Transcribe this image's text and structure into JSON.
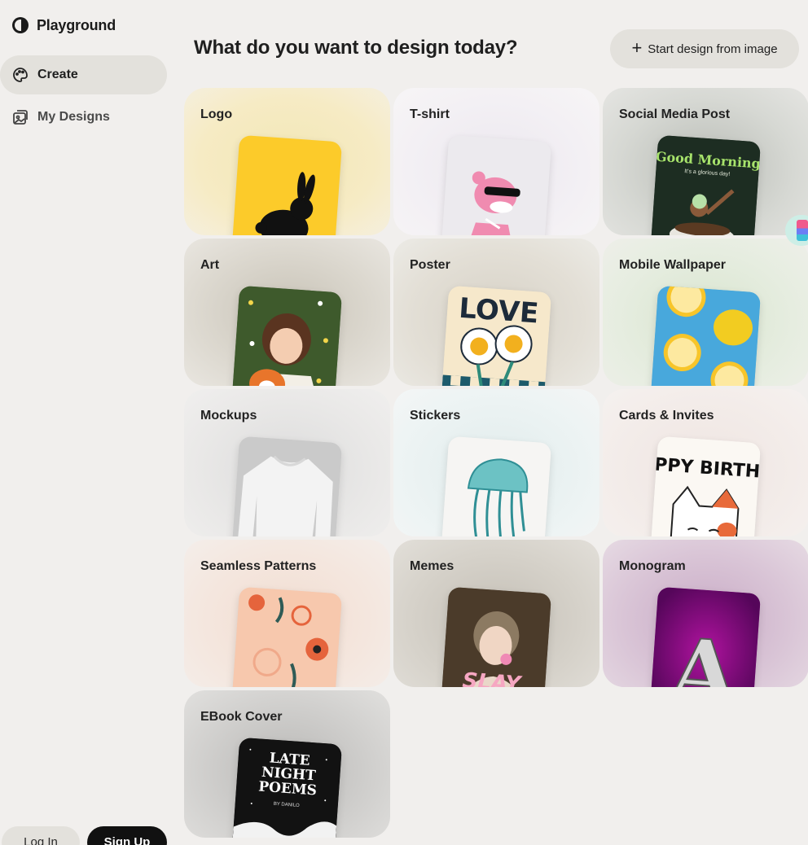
{
  "app": {
    "name": "Playground"
  },
  "sidebar": {
    "items": [
      {
        "label": "Create",
        "icon": "palette-icon",
        "active": true
      },
      {
        "label": "My Designs",
        "icon": "gallery-icon",
        "active": false
      }
    ],
    "login_label": "Log In",
    "signup_label": "Sign Up"
  },
  "header": {
    "title": "What do you want to design today?",
    "start_button_label": "Start design from image"
  },
  "cards": [
    {
      "label": "Logo"
    },
    {
      "label": "T-shirt"
    },
    {
      "label": "Social Media Post",
      "thumb_title": "Good Morning",
      "thumb_subtitle": "It's a glorious day!"
    },
    {
      "label": "Art"
    },
    {
      "label": "Poster",
      "thumb_title": "LOVE"
    },
    {
      "label": "Mobile Wallpaper"
    },
    {
      "label": "Mockups"
    },
    {
      "label": "Stickers"
    },
    {
      "label": "Cards & Invites",
      "thumb_title": "APPY BIRTHD"
    },
    {
      "label": "Seamless Patterns"
    },
    {
      "label": "Memes",
      "thumb_title": "SLAY"
    },
    {
      "label": "Monogram",
      "thumb_title": "A"
    },
    {
      "label": "EBook Cover",
      "thumb_title_lines": [
        "LATE",
        "NIGHT",
        "POEMS"
      ],
      "thumb_author": "BY DANILO"
    }
  ],
  "colors": {
    "background": "#f1efed",
    "nav_active": "#e3e1dc",
    "signup_bg": "#111111"
  }
}
